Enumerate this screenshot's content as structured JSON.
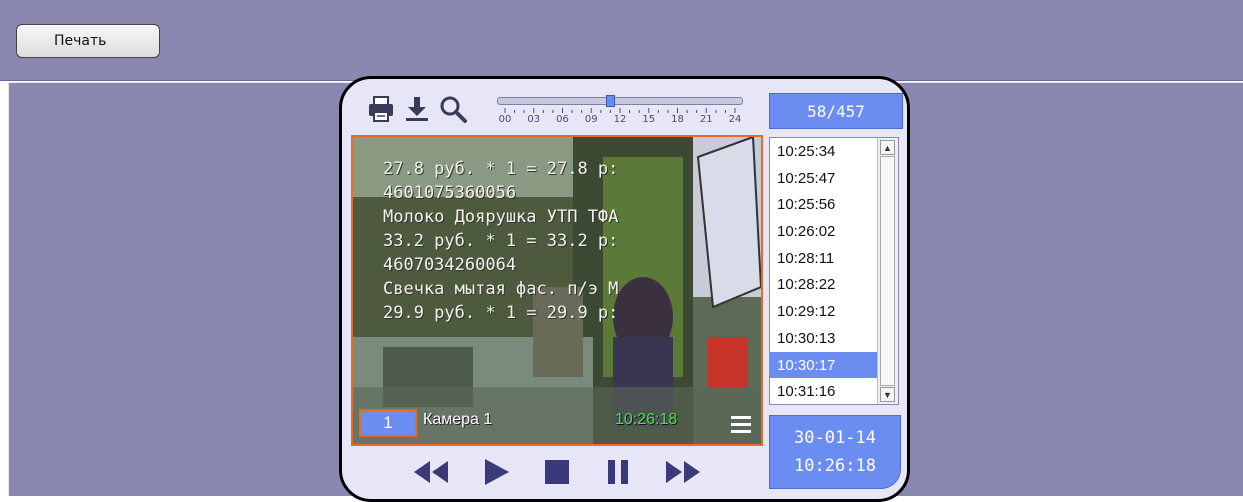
{
  "toolbar": {
    "print_label": "Печать"
  },
  "player": {
    "icons": [
      "print-icon",
      "download-icon",
      "search-icon"
    ],
    "timeline": {
      "labels": [
        "00",
        "03",
        "06",
        "09",
        "12",
        "15",
        "18",
        "21",
        "24"
      ],
      "position_fraction": 0.45
    },
    "counter": "58/457",
    "video": {
      "overlay_lines": [
        "27.8 руб. * 1 = 27.8 р:",
        "4601075360056",
        "Молоко Доярушка УТП ТФА",
        "33.2 руб. * 1 = 33.2 р:",
        "4607034260064",
        "Свечка мытая фас. п/э М",
        "29.9 руб. * 1 = 29.9 р:"
      ],
      "camera_number": "1",
      "camera_name": "Камера 1",
      "camera_time": "10:26:18"
    },
    "times": [
      "10:25:34",
      "10:25:47",
      "10:25:56",
      "10:26:02",
      "10:28:11",
      "10:28:22",
      "10:29:12",
      "10:30:13",
      "10:30:17",
      "10:31:16"
    ],
    "selected_time_index": 8,
    "date": "30-01-14",
    "time": "10:26:18",
    "controls": [
      "rewind-icon",
      "play-icon",
      "stop-icon",
      "pause-icon",
      "fast-forward-icon"
    ]
  },
  "colors": {
    "background": "#8a88b0",
    "panel": "#e6e6f6",
    "accent": "#6b8df2",
    "frame": "#e86a28",
    "camera_time": "#3fe64a"
  }
}
